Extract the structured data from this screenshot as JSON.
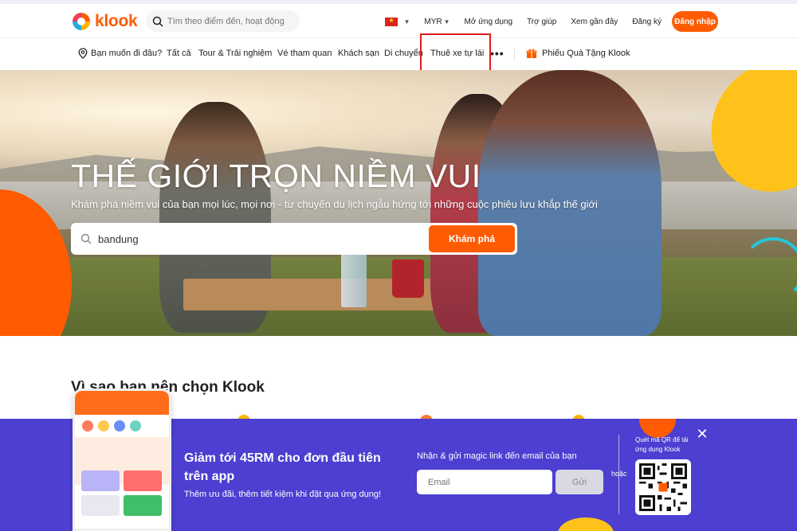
{
  "brand": {
    "name": "klook",
    "accent": "#ff5b00"
  },
  "top_search": {
    "placeholder": "Tìm theo điểm đến, hoạt động"
  },
  "top_links": {
    "currency": "MYR",
    "open_app": "Mở ứng dụng",
    "help": "Trợ giúp",
    "recently_viewed": "Xem gần đây",
    "signup": "Đăng ký",
    "login": "Đăng nhập"
  },
  "nav": {
    "where": "Bạn muốn đi đâu?",
    "items": [
      "Tất cả",
      "Tour & Trải nghiệm",
      "Vé tham quan",
      "Khách sạn",
      "Di chuyển",
      "Thuê xe tự lái"
    ],
    "more": "•••",
    "gift": "Phiếu Quà Tặng Klook"
  },
  "hero": {
    "title": "THẾ GIỚI TRỌN NIỀM VUI",
    "subtitle": "Khám phá niềm vui của bạn mọi lúc, mọi nơi - từ chuyến du lịch ngẫu hứng tới những cuộc phiêu lưu khắp thế giới",
    "search_value": "bandung",
    "search_button": "Khám phá"
  },
  "why_section": {
    "title": "Vì sao bạn nên chọn Klook"
  },
  "promo": {
    "title": "Giảm tới 45RM cho đơn đầu tiên trên app",
    "subtitle": "Thêm ưu đãi, thêm tiết kiệm khi đặt qua ứng dụng!",
    "email_label": "Nhận & gửi magic link đến email của bạn",
    "email_placeholder": "Email",
    "send_button": "Gửi",
    "or": "hoặc",
    "qr_text": "Quét mã QR để tải ứng dụng Klook",
    "background": "#4c3fd1"
  },
  "icons": [
    "search-icon",
    "location-pin-icon",
    "gift-icon",
    "close-icon",
    "chevron-down-icon",
    "vietnam-flag-icon",
    "qr-code-icon"
  ]
}
